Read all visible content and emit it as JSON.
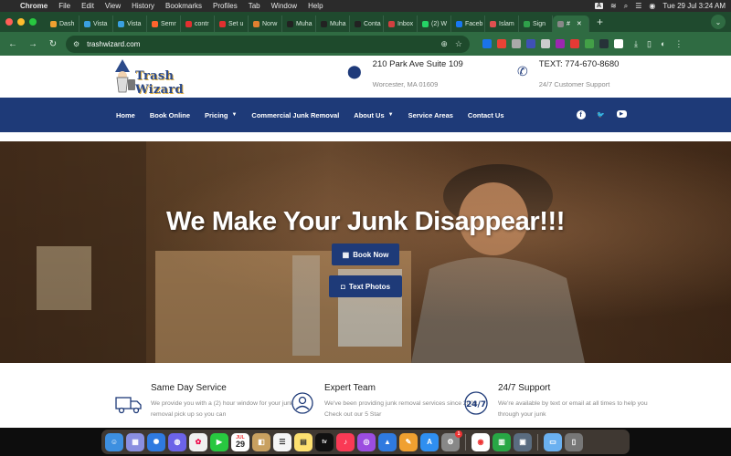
{
  "menubar": {
    "app": "Chrome",
    "items": [
      "File",
      "Edit",
      "View",
      "History",
      "Bookmarks",
      "Profiles",
      "Tab",
      "Window",
      "Help"
    ],
    "input_badge": "A",
    "datetime": "Tue 29 Jul  3:24 AM"
  },
  "tabs": [
    {
      "label": "Dash",
      "color": "#f0a030"
    },
    {
      "label": "Vista",
      "color": "#3aa0e0"
    },
    {
      "label": "Vista",
      "color": "#3aa0e0"
    },
    {
      "label": "Semr",
      "color": "#ff642d"
    },
    {
      "label": "contr",
      "color": "#e03030"
    },
    {
      "label": "Set u",
      "color": "#e03030"
    },
    {
      "label": "Norw",
      "color": "#e08030"
    },
    {
      "label": "Muha",
      "color": "#222222"
    },
    {
      "label": "Muha",
      "color": "#222222"
    },
    {
      "label": "Conta",
      "color": "#222222"
    },
    {
      "label": "Inbox",
      "color": "#d04040"
    },
    {
      "label": "(2) W",
      "color": "#25d366"
    },
    {
      "label": "Faceb",
      "color": "#1877f2"
    },
    {
      "label": "Islam",
      "color": "#e05050"
    },
    {
      "label": "Sign",
      "color": "#2fa04a"
    },
    {
      "label": "#",
      "color": "#888888",
      "active": true
    }
  ],
  "browser": {
    "url": "trashwizard.com"
  },
  "site": {
    "logo_text": "Trash Wizard",
    "address_line1": "210 Park Ave Suite 109",
    "address_line2": "Worcester, MA 01609",
    "phone_line1": "TEXT: 774-670-8680",
    "phone_line2": "24/7 Customer Support",
    "nav": [
      {
        "label": "Home",
        "dropdown": false
      },
      {
        "label": "Book Online",
        "dropdown": false
      },
      {
        "label": "Pricing",
        "dropdown": true
      },
      {
        "label": "Commercial Junk Removal",
        "dropdown": false
      },
      {
        "label": "About Us",
        "dropdown": true
      },
      {
        "label": "Service Areas",
        "dropdown": false
      },
      {
        "label": "Contact Us",
        "dropdown": false
      }
    ],
    "hero_title": "We Make Your Junk Disappear!!!",
    "btn_book": "Book Now",
    "btn_photos": "Text Photos",
    "features": [
      {
        "title": "Same Day Service",
        "text": "We provide you with a (2) hour window for your junk removal pick up so you can",
        "icon": "truck-icon"
      },
      {
        "title": "Expert Team",
        "text": "We've been providing junk removal services since 2009. Check out our 5 Star",
        "icon": "team-icon"
      },
      {
        "title": "24/7 Support",
        "text": "We're available by text or email at all times to help you through your junk",
        "icon": "support-24-7-icon"
      }
    ],
    "brand_color": "#1e3a78"
  },
  "dock": {
    "calendar_month": "JUL",
    "calendar_day": "29",
    "appletv_label": "tv",
    "reminder_badge": "1"
  }
}
